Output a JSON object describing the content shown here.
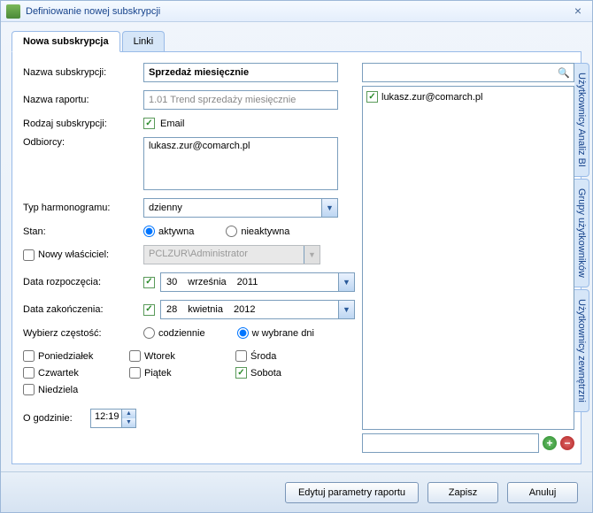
{
  "window": {
    "title": "Definiowanie nowej subskrypcji"
  },
  "tabs": {
    "sub": "Nowa subskrypcja",
    "links": "Linki"
  },
  "labels": {
    "name": "Nazwa subskrypcji:",
    "report": "Nazwa raportu:",
    "type": "Rodzaj subskrypcji:",
    "recipients": "Odbiorcy:",
    "schedule": "Typ harmonogramu:",
    "state": "Stan:",
    "newowner": "Nowy właściciel:",
    "start": "Data rozpoczęcia:",
    "end": "Data zakończenia:",
    "freq": "Wybierz częstość:",
    "hour": "O godzinie:"
  },
  "values": {
    "name": "Sprzedaż miesięcznie",
    "report": "1.01 Trend sprzedaży miesięcznie",
    "email": "Email",
    "recipients": "lukasz.zur@comarch.pl",
    "schedule": "dzienny",
    "active": "aktywna",
    "inactive": "nieaktywna",
    "owner": "PCLZUR\\Administrator",
    "start": {
      "d": "30",
      "m": "września",
      "y": "2011"
    },
    "end": {
      "d": "28",
      "m": "kwietnia",
      "y": "2012"
    },
    "freq_daily": "codziennie",
    "freq_selected": "w wybrane dni",
    "time": "12:19"
  },
  "days": {
    "mon": "Poniedziałek",
    "tue": "Wtorek",
    "wed": "Środa",
    "thu": "Czwartek",
    "fri": "Piątek",
    "sat": "Sobota",
    "sun": "Niedziela"
  },
  "userlist": {
    "item0": "lukasz.zur@comarch.pl"
  },
  "sidetabs": {
    "a": "Użytkownicy Analiz BI",
    "b": "Grupy użytkowników",
    "c": "Użytkownicy zewnętrzni"
  },
  "footer": {
    "edit": "Edytuj parametry raportu",
    "save": "Zapisz",
    "cancel": "Anuluj"
  }
}
